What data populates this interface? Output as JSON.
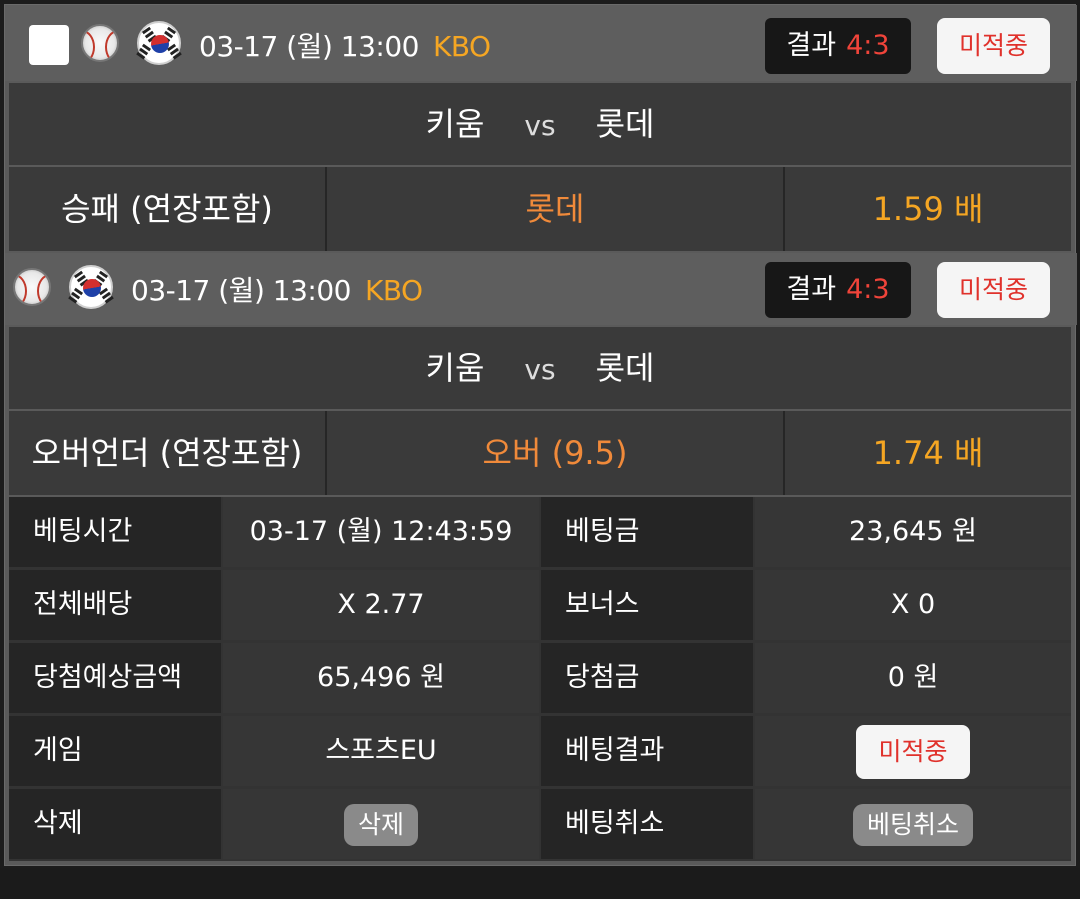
{
  "bets": [
    {
      "date": "03-17 (월) 13:00",
      "league": "KBO",
      "result_label": "결과",
      "score": "4:3",
      "status": "미적중",
      "home": "키움",
      "vs": "vs",
      "away": "롯데",
      "market": "승패 (연장포함)",
      "pick": "롯데",
      "odds": "1.59 배"
    },
    {
      "date": "03-17 (월) 13:00",
      "league": "KBO",
      "result_label": "결과",
      "score": "4:3",
      "status": "미적중",
      "home": "키움",
      "vs": "vs",
      "away": "롯데",
      "market": "오버언더 (연장포함)",
      "pick": "오버 (9.5)",
      "odds": "1.74 배"
    }
  ],
  "summary": {
    "rows": [
      {
        "l1": "베팅시간",
        "v1": "03-17 (월) 12:43:59",
        "l2": "베팅금",
        "v2": "23,645 원"
      },
      {
        "l1": "전체배당",
        "v1": "X 2.77",
        "l2": "보너스",
        "v2": "X 0"
      },
      {
        "l1": "당첨예상금액",
        "v1": "65,496 원",
        "l2": "당첨금",
        "v2": "0 원"
      },
      {
        "l1": "게임",
        "v1": "스포츠EU",
        "l2": "베팅결과",
        "v2": "미적중"
      },
      {
        "l1": "삭제",
        "v1": "삭제",
        "l2": "베팅취소",
        "v2": "베팅취소"
      }
    ]
  },
  "colors": {
    "accent_orange": "#f5a623",
    "pick_orange": "#f08a3a",
    "loss_red": "#e0312b",
    "score_red": "#f0443a"
  },
  "icons": [
    "checkbox-icon",
    "baseball-icon",
    "korea-flag-icon"
  ]
}
